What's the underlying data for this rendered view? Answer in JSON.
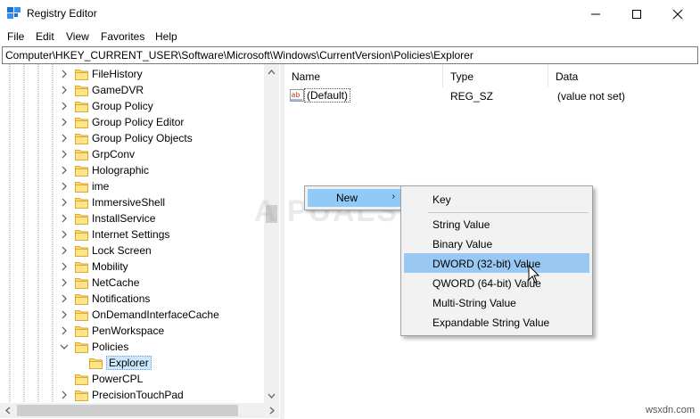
{
  "window": {
    "title": "Registry Editor",
    "buttons": {
      "minimize": "—",
      "maximize": "☐",
      "close": "✕"
    }
  },
  "menubar": {
    "items": [
      "File",
      "Edit",
      "View",
      "Favorites",
      "Help"
    ]
  },
  "address": {
    "path": "Computer\\HKEY_CURRENT_USER\\Software\\Microsoft\\Windows\\CurrentVersion\\Policies\\Explorer"
  },
  "tree": {
    "items": [
      {
        "label": "FileHistory",
        "expander": "collapsed"
      },
      {
        "label": "GameDVR",
        "expander": "collapsed"
      },
      {
        "label": "Group Policy",
        "expander": "collapsed"
      },
      {
        "label": "Group Policy Editor",
        "expander": "collapsed"
      },
      {
        "label": "Group Policy Objects",
        "expander": "collapsed"
      },
      {
        "label": "GrpConv",
        "expander": "collapsed"
      },
      {
        "label": "Holographic",
        "expander": "collapsed"
      },
      {
        "label": "ime",
        "expander": "collapsed"
      },
      {
        "label": "ImmersiveShell",
        "expander": "collapsed"
      },
      {
        "label": "InstallService",
        "expander": "collapsed"
      },
      {
        "label": "Internet Settings",
        "expander": "collapsed"
      },
      {
        "label": "Lock Screen",
        "expander": "collapsed"
      },
      {
        "label": "Mobility",
        "expander": "collapsed"
      },
      {
        "label": "NetCache",
        "expander": "collapsed"
      },
      {
        "label": "Notifications",
        "expander": "collapsed"
      },
      {
        "label": "OnDemandInterfaceCache",
        "expander": "collapsed"
      },
      {
        "label": "PenWorkspace",
        "expander": "collapsed"
      },
      {
        "label": "Policies",
        "expander": "expanded"
      },
      {
        "label": "Explorer",
        "expander": "none",
        "selected": true,
        "child": true
      },
      {
        "label": "PowerCPL",
        "expander": "none"
      },
      {
        "label": "PrecisionTouchPad",
        "expander": "collapsed"
      }
    ]
  },
  "list": {
    "columns": [
      "Name",
      "Type",
      "Data"
    ],
    "rows": [
      {
        "name": "(Default)",
        "type": "REG_SZ",
        "data": "(value not set)"
      }
    ]
  },
  "context_menu": {
    "new_label": "New",
    "submenu": [
      "Key",
      "String Value",
      "Binary Value",
      "DWORD (32-bit) Value",
      "QWORD (64-bit) Value",
      "Multi-String Value",
      "Expandable String Value"
    ],
    "highlighted": "DWORD (32-bit) Value"
  },
  "watermark": {
    "brand": "A PUALS",
    "site": "wsxdn.com"
  },
  "colors": {
    "selection": "#cce8ff",
    "menu_highlight": "#99c9f2",
    "folder": "#ffd96b"
  }
}
